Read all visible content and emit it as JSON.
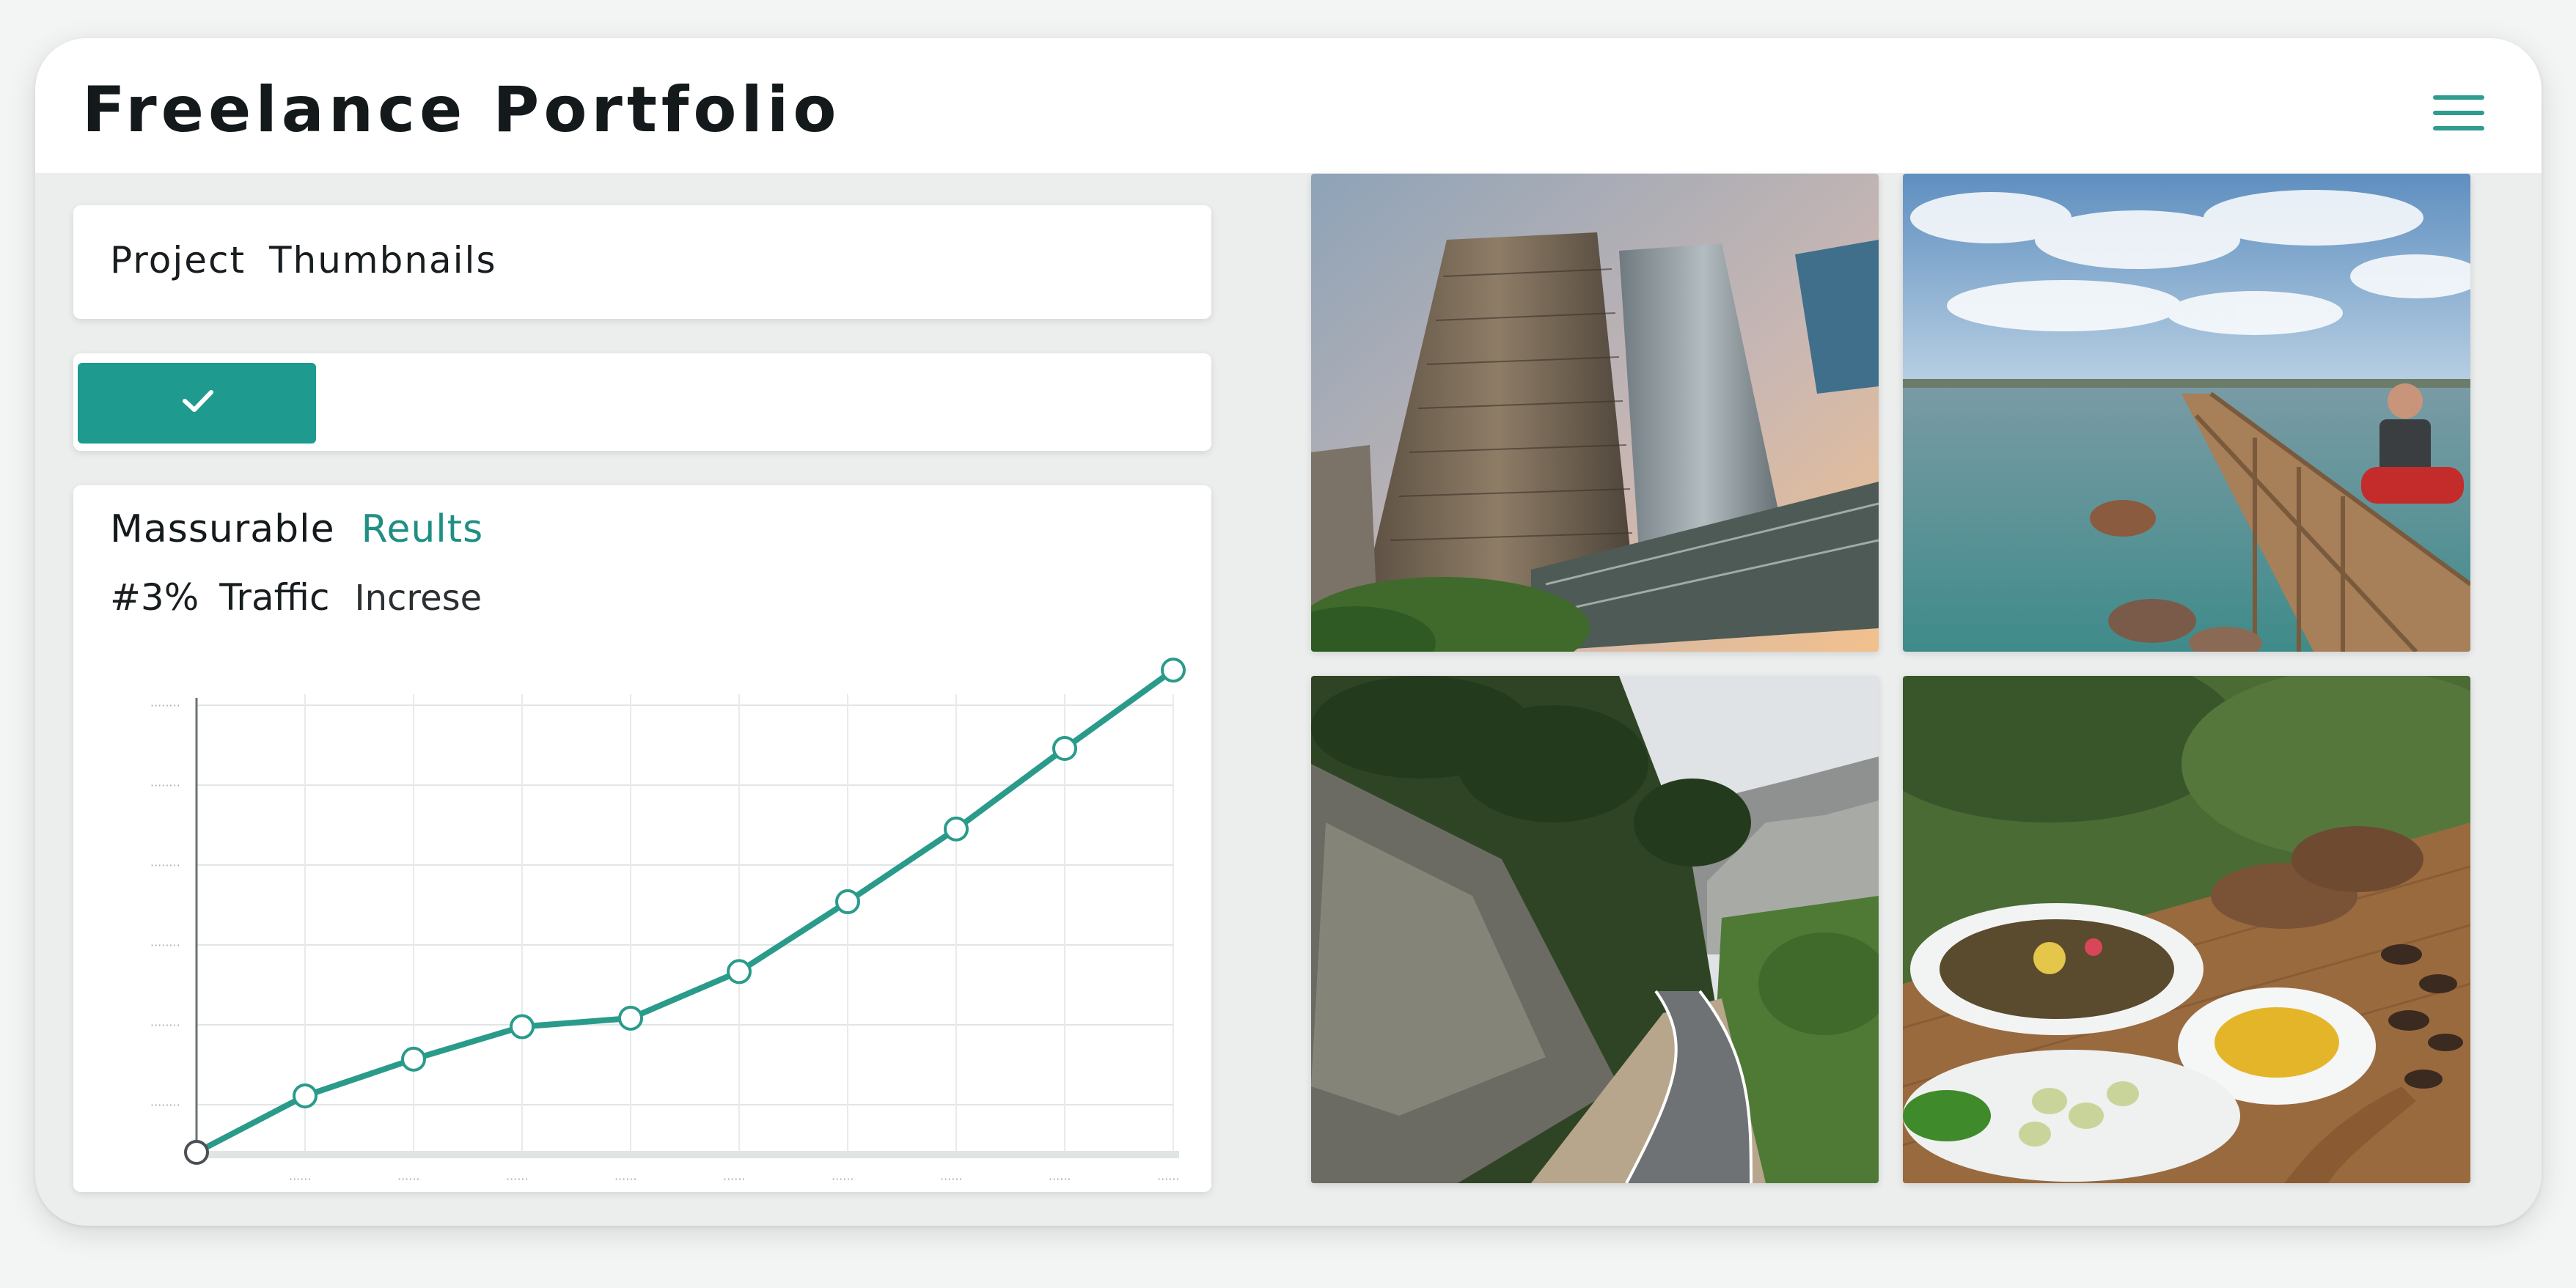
{
  "app": {
    "title": "Freelance Portfolio"
  },
  "header": {
    "menu_icon": "hamburger-menu-icon",
    "accent_color": "#2f9c8f"
  },
  "sidebar": {
    "section_title": "Project  Thumbnails",
    "filter": {
      "button_icon": "checkmark-icon",
      "button_color": "#1e9a8e"
    }
  },
  "results": {
    "title_part1": "Massurable",
    "title_part2": "Reults",
    "metric_value": "#3%",
    "metric_label": "Traffic",
    "metric_suffix": "Increse"
  },
  "chart_data": {
    "type": "line",
    "title": "",
    "xlabel": "",
    "ylabel": "",
    "series": [
      {
        "values": [
          0,
          0.8,
          1.32,
          1.78,
          1.9,
          2.56,
          3.55,
          4.58,
          5.72,
          6.83
        ]
      }
    ],
    "ylim": [
      0,
      6.8
    ],
    "grid": true,
    "line_color": "#2a9b8b",
    "marker": "hollow-circle",
    "tick_labels_illegible": true
  },
  "gallery": {
    "thumbnails": [
      {
        "subject": "skyscraper"
      },
      {
        "subject": "lake-pier"
      },
      {
        "subject": "mountain-road"
      },
      {
        "subject": "food-platter"
      }
    ]
  }
}
